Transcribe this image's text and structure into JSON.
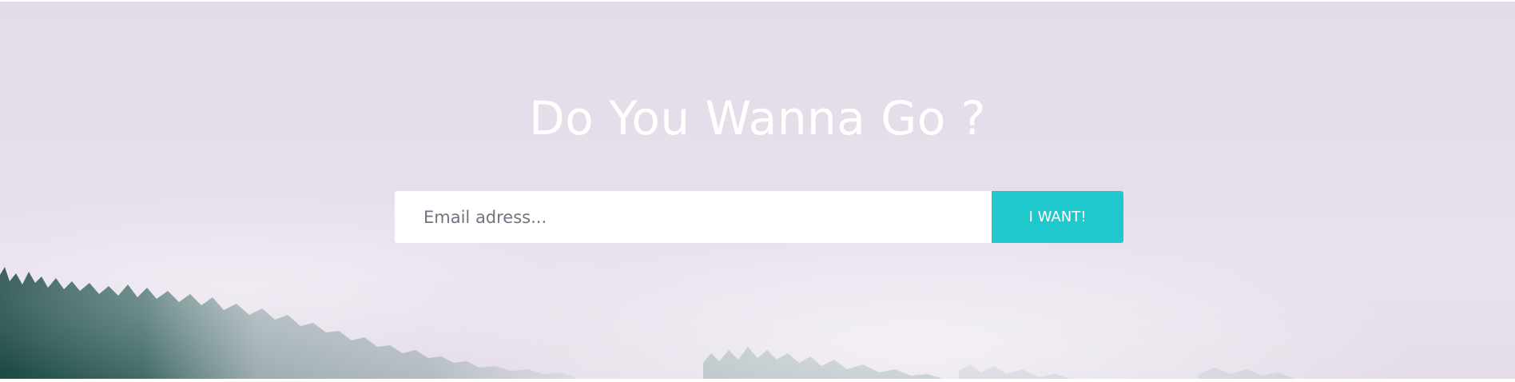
{
  "hero": {
    "title": "Do You Wanna Go ?",
    "background_image": "misty-forest"
  },
  "signup": {
    "email_placeholder": "Email adress...",
    "email_value": "",
    "button_label": "I WANT!"
  },
  "colors": {
    "accent": "#1fc8cc",
    "title_text": "#ffffff",
    "background_tint": "#e6deeb",
    "forest_dark": "#1f4a44"
  }
}
